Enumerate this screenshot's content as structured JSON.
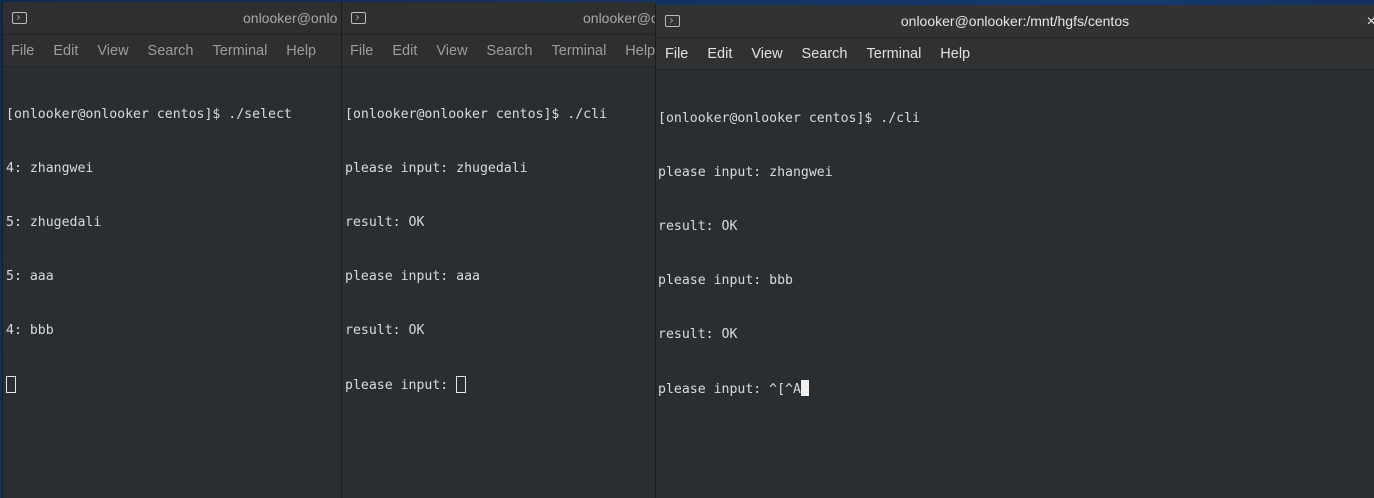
{
  "windows": [
    {
      "title": "onlooker@onlooker:/mnt/hgfs/centos",
      "title_visible": "onlooker@onlo",
      "menu": [
        "File",
        "Edit",
        "View",
        "Search",
        "Terminal",
        "Help"
      ],
      "lines": [
        "[onlooker@onlooker centos]$ ./select",
        "4: zhangwei",
        "5: zhugedali",
        "5: aaa",
        "4: bbb"
      ],
      "cursor_line": ""
    },
    {
      "title": "onlooker@onlooker:/mnt/hgfs/centos",
      "title_visible": "onlooker@o",
      "menu": [
        "File",
        "Edit",
        "View",
        "Search",
        "Terminal",
        "Help"
      ],
      "lines": [
        "[onlooker@onlooker centos]$ ./cli",
        "please input: zhugedali",
        "result: OK",
        "please input: aaa",
        "result: OK"
      ],
      "cursor_line": "please input: "
    },
    {
      "title": "onlooker@onlooker:/mnt/hgfs/centos",
      "menu": [
        "File",
        "Edit",
        "View",
        "Search",
        "Terminal",
        "Help"
      ],
      "lines": [
        "[onlooker@onlooker centos]$ ./cli",
        "please input: zhangwei",
        "result: OK",
        "please input: bbb",
        "result: OK"
      ],
      "cursor_line": "please input: ^[^A",
      "close_glyph": "×"
    }
  ]
}
